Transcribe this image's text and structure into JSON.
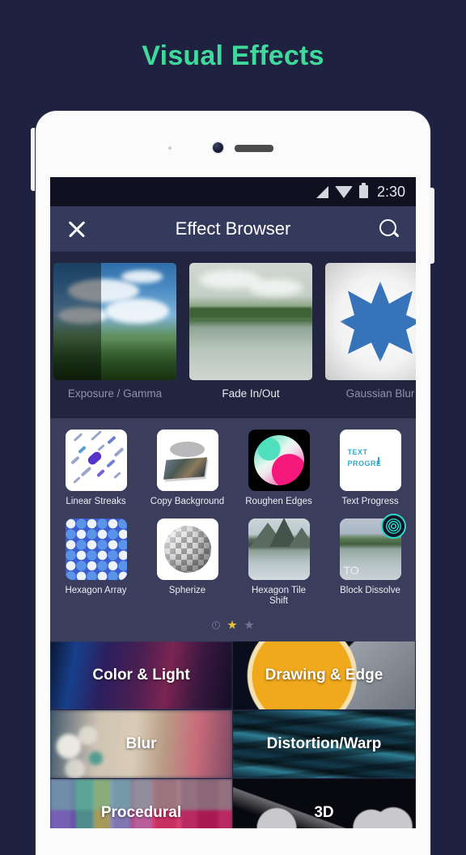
{
  "page": {
    "title": "Visual Effects",
    "title_color": "#3fd99b",
    "background_color": "#1e2240"
  },
  "statusbar": {
    "time": "2:30",
    "icons": [
      "signal-icon",
      "wifi-icon",
      "battery-icon"
    ]
  },
  "appbar": {
    "close_icon": "close-icon",
    "title": "Effect Browser",
    "search_icon": "search-icon",
    "background_color": "#343a5c"
  },
  "carousel": {
    "items": [
      {
        "label": "Exposure / Gamma",
        "dim": true
      },
      {
        "label": "Fade In/Out",
        "dim": false
      },
      {
        "label": "Gaussian Blur",
        "dim": true
      }
    ]
  },
  "grid": {
    "rows": [
      [
        {
          "label": "Linear Streaks",
          "art": "linear-streaks"
        },
        {
          "label": "Copy\nBackground",
          "art": "copy-background"
        },
        {
          "label": "Roughen Edges",
          "art": "roughen-edges"
        },
        {
          "label": "Text Progress",
          "art": "text-progress",
          "thumb_text": "TEXT PROGRE"
        }
      ],
      [
        {
          "label": "Hexagon Array",
          "art": "hexagon-array"
        },
        {
          "label": "Spherize",
          "art": "spherize"
        },
        {
          "label": "Hexagon Tile\nShift",
          "art": "hexagon-tile-shift"
        },
        {
          "label": "Block Dissolve",
          "art": "block-dissolve",
          "thumb_text": "TO",
          "badge": "ripple-badge"
        }
      ]
    ]
  },
  "pager": {
    "indicators": [
      "clock-icon",
      "star-filled-icon",
      "star-outline-icon"
    ],
    "active_index": 1,
    "active_color": "#e8c235",
    "inactive_color": "#6f7490"
  },
  "categories": [
    {
      "label": "Color & Light",
      "bg": "bg-color"
    },
    {
      "label": "Drawing & Edge",
      "bg": "bg-drawing"
    },
    {
      "label": "Blur",
      "bg": "bg-blur"
    },
    {
      "label": "Distortion/Warp",
      "bg": "bg-distort"
    },
    {
      "label": "Procedural",
      "bg": "bg-proc"
    },
    {
      "label": "3D",
      "bg": "bg-3d"
    }
  ]
}
